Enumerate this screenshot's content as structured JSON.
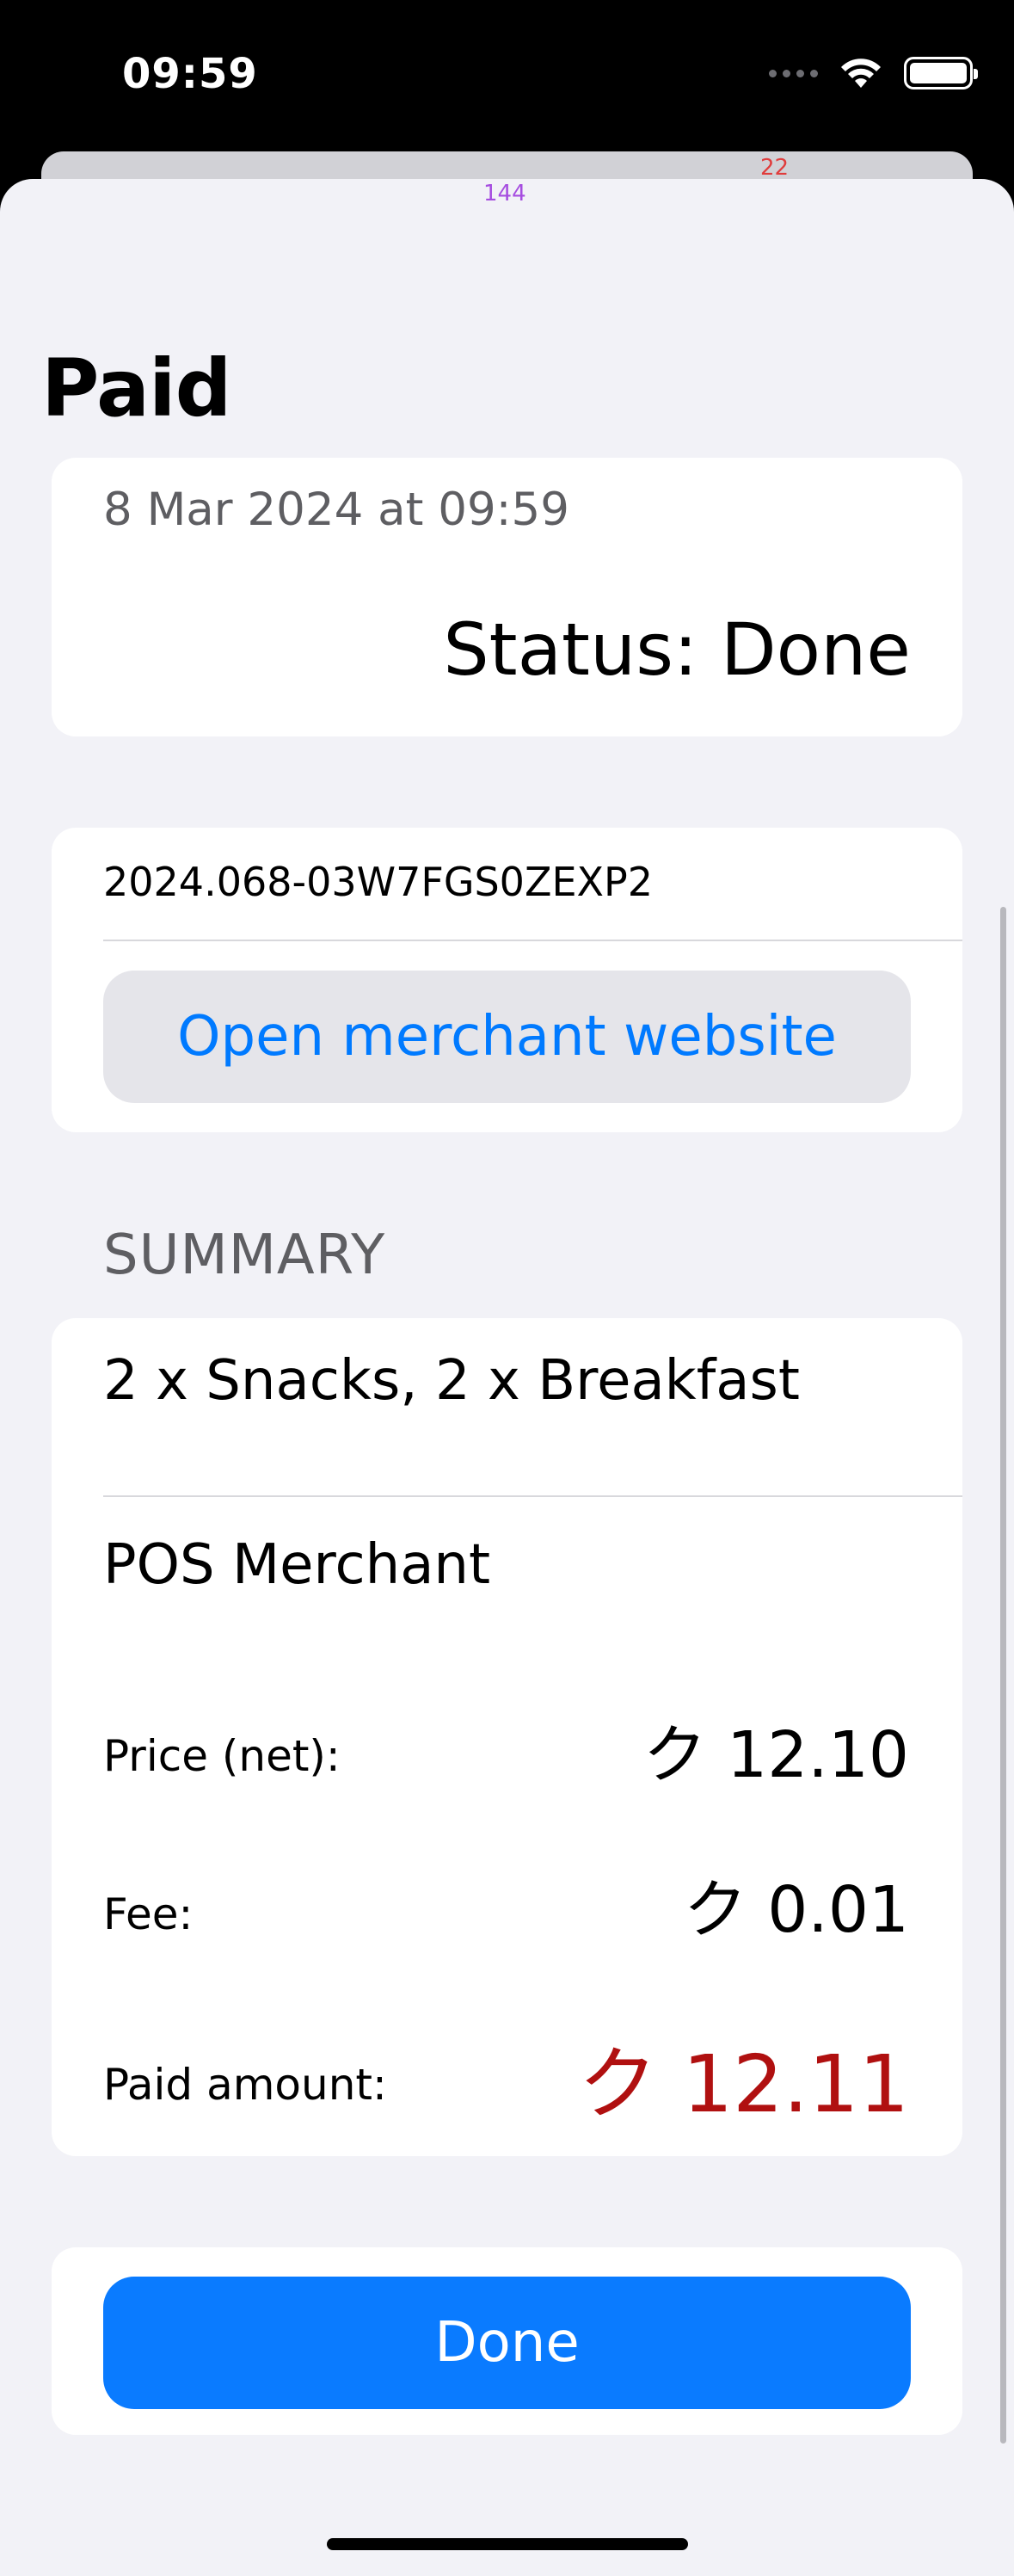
{
  "status_bar": {
    "time": "09:59",
    "icons": [
      "cellular-dots-icon",
      "wifi-icon",
      "battery-icon"
    ]
  },
  "debug_labels": [
    "144",
    "22"
  ],
  "page": {
    "title": "Paid"
  },
  "payment_info": {
    "date": "8 Mar 2024 at 09:59",
    "status": "Status: Done"
  },
  "reference": {
    "id": "2024.068-03W7FGS0ZEXP2",
    "merchant_button_label": "Open merchant website"
  },
  "summary": {
    "section_title": "SUMMARY",
    "items": "2 x Snacks, 2 x Breakfast",
    "merchant": "POS Merchant",
    "price_net_label": "Price (net):",
    "price_net_value": "ク 12.10",
    "fee_label": "Fee:",
    "fee_value": "ク 0.01",
    "paid_amount_label": "Paid amount:",
    "paid_amount_value": "ク 12.11"
  },
  "actions": {
    "done_label": "Done"
  },
  "colors": {
    "accent": "#007aff",
    "done_button": "#0a7bff",
    "paid_amount": "#b01010",
    "background": "#f2f2f7"
  }
}
